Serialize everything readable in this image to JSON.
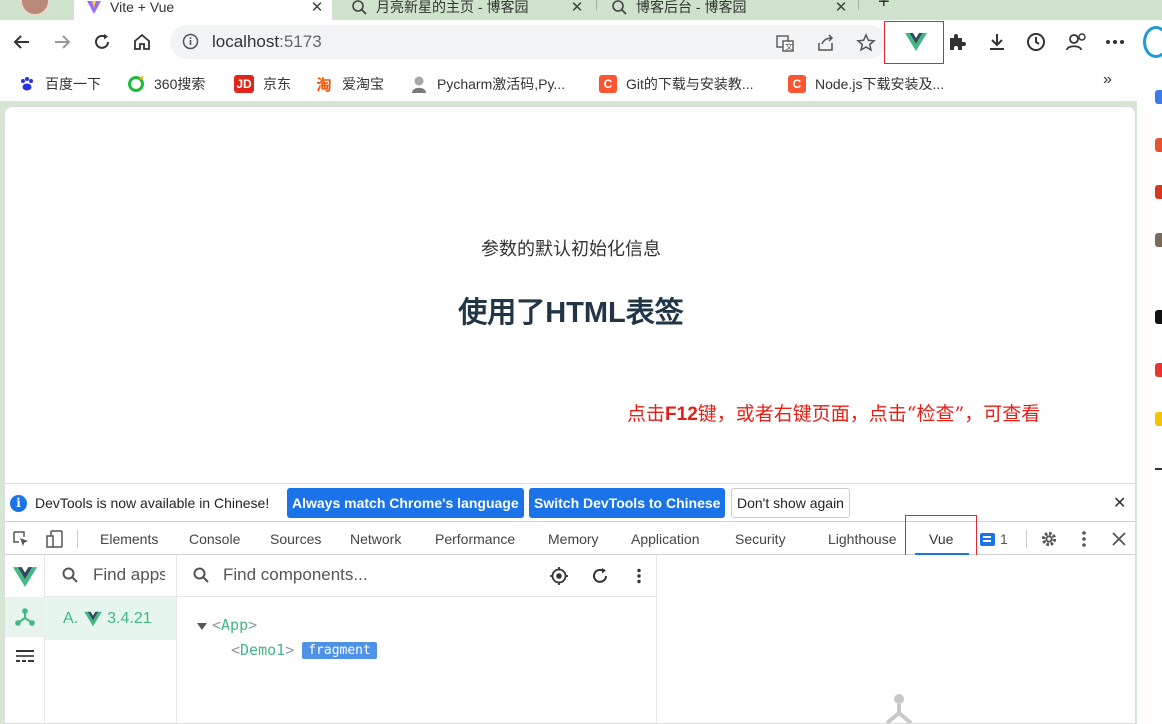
{
  "browser": {
    "tabs": [
      {
        "title": "Vite + Vue",
        "active": true
      },
      {
        "title": "月亮新星的主页 - 博客园",
        "active": false
      },
      {
        "title": "博客后台 - 博客园",
        "active": false
      }
    ],
    "address": {
      "host": "localhost",
      "port": ":5173"
    },
    "bookmarks": [
      {
        "label": "百度一下",
        "icon": "baidu-paw-icon",
        "color": "#2932e1"
      },
      {
        "label": "360搜索",
        "icon": "360-search-icon",
        "color": "#1fb93b"
      },
      {
        "label": "京东",
        "icon": "jd-icon",
        "color": "#e1251b"
      },
      {
        "label": "爱淘宝",
        "icon": "taobao-icon",
        "color": "#ff5000"
      },
      {
        "label": "Pycharm激活码,Py...",
        "icon": "avatar-icon",
        "color": "#888888"
      },
      {
        "label": "Git的下载与安装教...",
        "icon": "csdn-c-icon",
        "color": "#fc5531"
      },
      {
        "label": "Node.js下载安装及...",
        "icon": "csdn-c-icon",
        "color": "#fc5531"
      }
    ]
  },
  "page": {
    "subtitle": "参数的默认初始化信息",
    "heading": "使用了HTML表签",
    "annotation": {
      "prefix": "点击",
      "key": "F12",
      "suffix": "键，或者右键页面，点击“检查”，可查看"
    }
  },
  "devtools": {
    "infobar": {
      "message": "DevTools is now available in Chinese!",
      "btn_match": "Always match Chrome's language",
      "btn_switch": "Switch DevTools to Chinese",
      "btn_dismiss": "Don't show again"
    },
    "tabs": [
      "Elements",
      "Console",
      "Sources",
      "Network",
      "Performance",
      "Memory",
      "Application",
      "Security",
      "Lighthouse",
      "Vue"
    ],
    "active_tab": "Vue",
    "issues_count": "1",
    "vue": {
      "apps_search_placeholder": "Find apps",
      "app_name": "A.",
      "app_version": "3.4.21",
      "components_search_placeholder": "Find components...",
      "tree": {
        "root": "App",
        "child": "Demo1",
        "child_badge": "fragment"
      }
    }
  },
  "colors": {
    "vue_green": "#42b883",
    "accent_blue": "#1a73e8",
    "annotation_red": "#e81e15",
    "highlight_red": "#e0282e"
  }
}
